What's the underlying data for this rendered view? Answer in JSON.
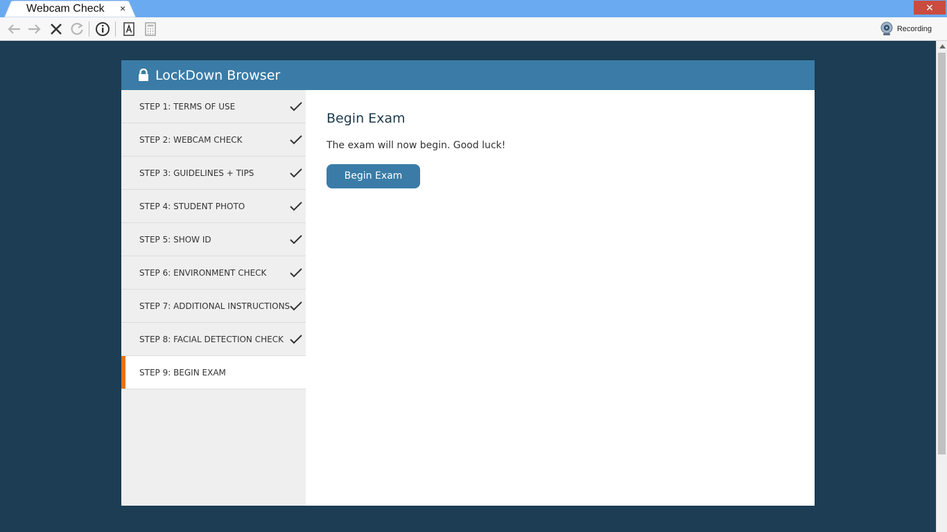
{
  "window": {
    "tab_title": "Webcam Check",
    "tab_close": "×",
    "close_glyph": "✕"
  },
  "toolbar": {
    "recording_label": "Recording"
  },
  "app": {
    "title": "LockDown Browser",
    "steps": [
      {
        "label": "STEP 1: TERMS OF USE",
        "completed": true
      },
      {
        "label": "STEP 2: WEBCAM CHECK",
        "completed": true
      },
      {
        "label": "STEP 3: GUIDELINES + TIPS",
        "completed": true
      },
      {
        "label": "STEP 4: STUDENT PHOTO",
        "completed": true
      },
      {
        "label": "STEP 5: SHOW ID",
        "completed": true
      },
      {
        "label": "STEP 6: ENVIRONMENT CHECK",
        "completed": true
      },
      {
        "label": "STEP 7: ADDITIONAL INSTRUCTIONS",
        "completed": true
      },
      {
        "label": "STEP 8: FACIAL DETECTION CHECK",
        "completed": true
      },
      {
        "label": "STEP 9: BEGIN EXAM",
        "completed": false,
        "active": true
      }
    ],
    "content": {
      "heading": "Begin Exam",
      "message": "The exam will now begin. Good luck!",
      "button_label": "Begin Exam"
    }
  },
  "colors": {
    "page_background": "#1c3d53",
    "header_blue": "#3a7ca7",
    "active_step_accent": "#e8730d",
    "titlebar_blue": "#6aaaf1",
    "close_red": "#c94c3f"
  }
}
